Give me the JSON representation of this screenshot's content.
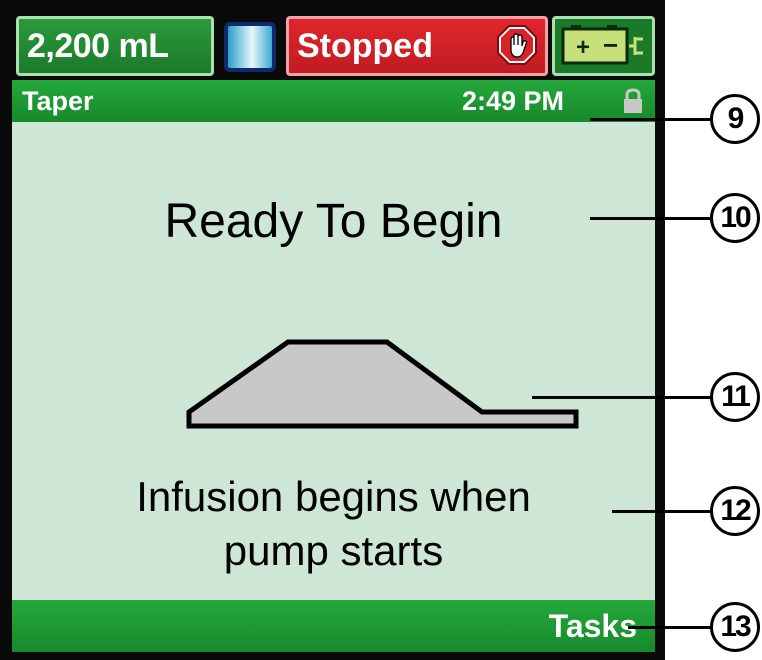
{
  "status_bar": {
    "volume": "2,200 mL",
    "state": "Stopped",
    "icons": [
      "iv-bag-icon",
      "stop-hand-icon",
      "battery-plugged-icon"
    ]
  },
  "title_bar": {
    "mode": "Taper",
    "time": "2:49 PM",
    "icon": "lock-icon"
  },
  "main": {
    "title": "Ready To Begin",
    "message_line1": "Infusion begins when",
    "message_line2": "pump starts",
    "graphic": "taper-profile-graphic"
  },
  "bottom_bar": {
    "tasks_label": "Tasks"
  },
  "callouts": [
    "9",
    "10",
    "11",
    "12",
    "13"
  ],
  "colors": {
    "screen_bg": "#cde6d6",
    "bar_green": "#1f9a34",
    "stopped_red": "#d9232a",
    "bezel": "#0a0a0a"
  }
}
